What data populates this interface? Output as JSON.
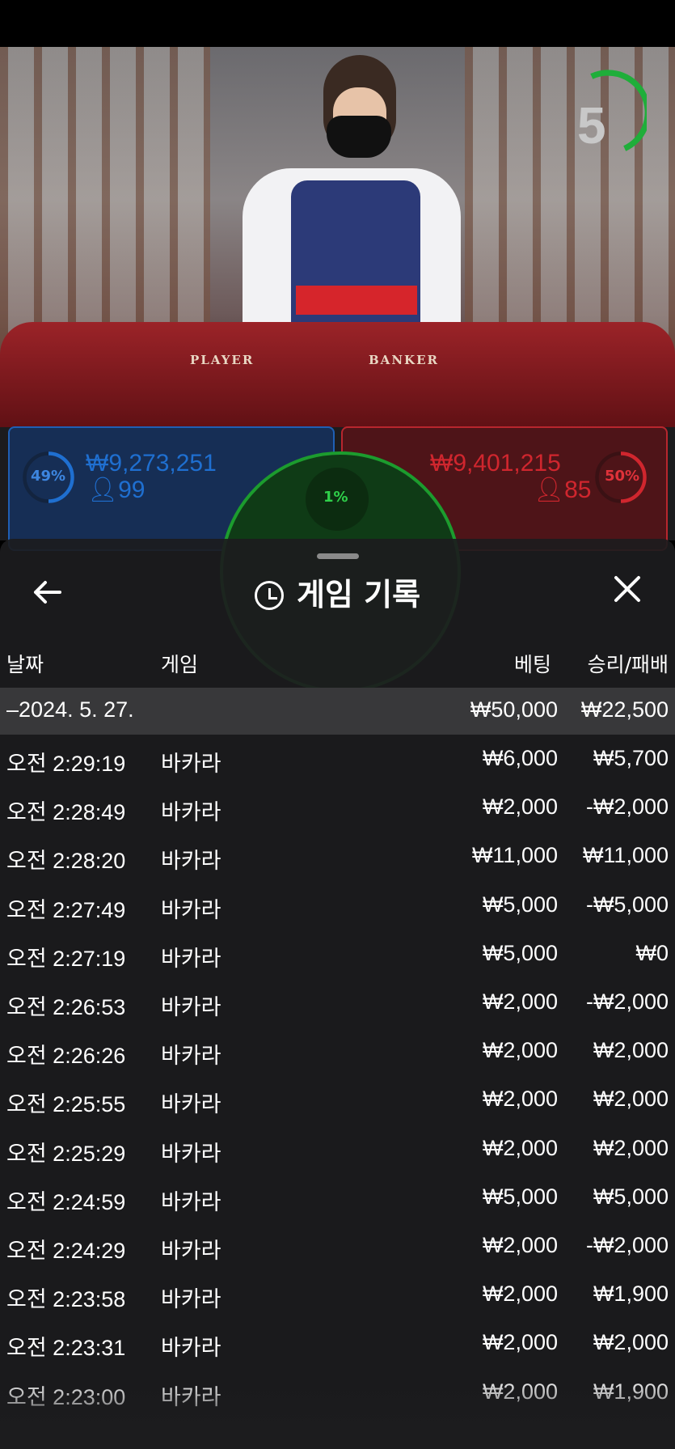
{
  "timer": {
    "value": "5"
  },
  "table": {
    "player_label": "PLAYER",
    "banker_label": "BANKER"
  },
  "player_bet": {
    "percent": "49%",
    "amount": "₩9,273,251",
    "count": "99"
  },
  "banker_bet": {
    "percent": "50%",
    "amount": "₩9,401,215",
    "count": "85"
  },
  "tie_bet": {
    "percent": "1%"
  },
  "sheet": {
    "title": "게임 기록",
    "columns": {
      "date": "날짜",
      "game": "게임",
      "bet": "베팅",
      "result": "승리/패배"
    },
    "date_group": {
      "date": "–2024. 5. 27.",
      "bet_total": "₩50,000",
      "result_total": "₩22,500"
    },
    "rows": [
      {
        "time": "오전 2:29:19",
        "game": "바카라",
        "bet": "₩6,000",
        "result": "₩5,700"
      },
      {
        "time": "오전 2:28:49",
        "game": "바카라",
        "bet": "₩2,000",
        "result": "-₩2,000"
      },
      {
        "time": "오전 2:28:20",
        "game": "바카라",
        "bet": "₩11,000",
        "result": "₩11,000"
      },
      {
        "time": "오전 2:27:49",
        "game": "바카라",
        "bet": "₩5,000",
        "result": "-₩5,000"
      },
      {
        "time": "오전 2:27:19",
        "game": "바카라",
        "bet": "₩5,000",
        "result": "₩0"
      },
      {
        "time": "오전 2:26:53",
        "game": "바카라",
        "bet": "₩2,000",
        "result": "-₩2,000"
      },
      {
        "time": "오전 2:26:26",
        "game": "바카라",
        "bet": "₩2,000",
        "result": "₩2,000"
      },
      {
        "time": "오전 2:25:55",
        "game": "바카라",
        "bet": "₩2,000",
        "result": "₩2,000"
      },
      {
        "time": "오전 2:25:29",
        "game": "바카라",
        "bet": "₩2,000",
        "result": "₩2,000"
      },
      {
        "time": "오전 2:24:59",
        "game": "바카라",
        "bet": "₩5,000",
        "result": "₩5,000"
      },
      {
        "time": "오전 2:24:29",
        "game": "바카라",
        "bet": "₩2,000",
        "result": "-₩2,000"
      },
      {
        "time": "오전 2:23:58",
        "game": "바카라",
        "bet": "₩2,000",
        "result": "₩1,900"
      },
      {
        "time": "오전 2:23:31",
        "game": "바카라",
        "bet": "₩2,000",
        "result": "₩2,000"
      },
      {
        "time": "오전 2:23:00",
        "game": "바카라",
        "bet": "₩2,000",
        "result": "₩1,900"
      }
    ]
  },
  "colors": {
    "player": "#1f6fd0",
    "banker": "#d0262e",
    "tie": "#1fae3a",
    "sheet_bg": "#1c1c1e"
  },
  "icons": {
    "back": "arrow-left-icon",
    "title": "history-icon",
    "close": "close-icon"
  }
}
